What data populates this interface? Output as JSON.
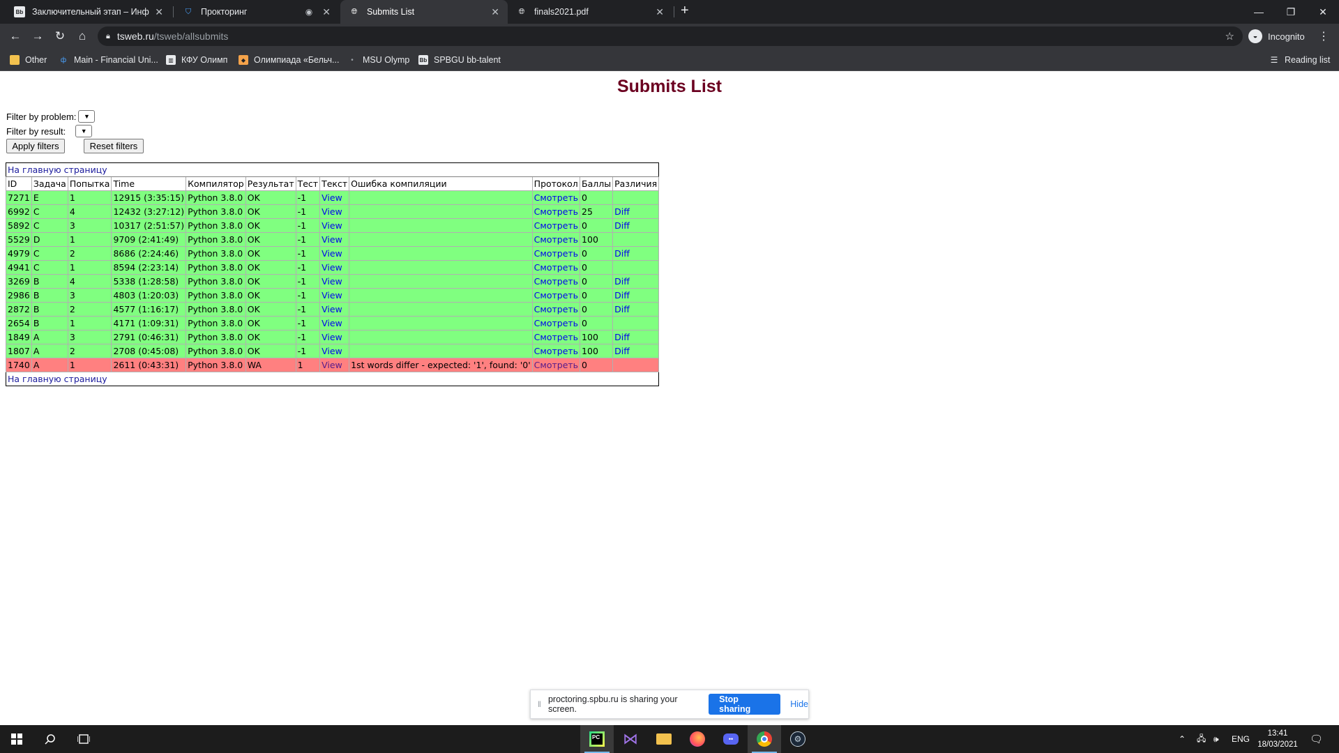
{
  "browser": {
    "tabs": [
      {
        "title": "Заключительный этап – Инфор",
        "icon": "bb-icon"
      },
      {
        "title": "Прокторинг",
        "icon": "shield-icon"
      },
      {
        "title": "Submits List",
        "icon": "globe-icon"
      },
      {
        "title": "finals2021.pdf",
        "icon": "globe-icon"
      }
    ],
    "address": {
      "host": "tsweb.ru",
      "path": "/tsweb/allsubmits"
    },
    "profile_label": "Incognito",
    "bookmarks": [
      "Other",
      "Main - Financial Uni...",
      "КФУ Олимп",
      "Олимпиада «Бельч...",
      "MSU Olymp",
      "SPBGU bb-talent"
    ],
    "reading_list": "Reading list"
  },
  "page": {
    "title": "Submits List",
    "filter_problem_label": "Filter by problem:",
    "filter_result_label": "Filter by result:",
    "apply_label": "Apply filters",
    "reset_label": "Reset filters",
    "home_link": "На главную страницу"
  },
  "table": {
    "headers": [
      "ID",
      "Задача",
      "Попытка",
      "Time",
      "Компилятор",
      "Результат",
      "Тест",
      "Текст",
      "Ошибка компиляции",
      "Протокол",
      "Баллы",
      "Различия"
    ],
    "rows": [
      {
        "id": "7271",
        "task": "E",
        "attempt": "1",
        "time": "12915 (3:35:15)",
        "compiler": "Python 3.8.0",
        "result": "OK",
        "test": "-1",
        "text": "View",
        "error": "",
        "protocol": "Смотреть",
        "score": "0",
        "diff": ""
      },
      {
        "id": "6992",
        "task": "C",
        "attempt": "4",
        "time": "12432 (3:27:12)",
        "compiler": "Python 3.8.0",
        "result": "OK",
        "test": "-1",
        "text": "View",
        "error": "",
        "protocol": "Смотреть",
        "score": "25",
        "diff": "Diff"
      },
      {
        "id": "5892",
        "task": "C",
        "attempt": "3",
        "time": "10317 (2:51:57)",
        "compiler": "Python 3.8.0",
        "result": "OK",
        "test": "-1",
        "text": "View",
        "error": "",
        "protocol": "Смотреть",
        "score": "0",
        "diff": "Diff"
      },
      {
        "id": "5529",
        "task": "D",
        "attempt": "1",
        "time": "9709 (2:41:49)",
        "compiler": "Python 3.8.0",
        "result": "OK",
        "test": "-1",
        "text": "View",
        "error": "",
        "protocol": "Смотреть",
        "score": "100",
        "diff": ""
      },
      {
        "id": "4979",
        "task": "C",
        "attempt": "2",
        "time": "8686 (2:24:46)",
        "compiler": "Python 3.8.0",
        "result": "OK",
        "test": "-1",
        "text": "View",
        "error": "",
        "protocol": "Смотреть",
        "score": "0",
        "diff": "Diff"
      },
      {
        "id": "4941",
        "task": "C",
        "attempt": "1",
        "time": "8594 (2:23:14)",
        "compiler": "Python 3.8.0",
        "result": "OK",
        "test": "-1",
        "text": "View",
        "error": "",
        "protocol": "Смотреть",
        "score": "0",
        "diff": ""
      },
      {
        "id": "3269",
        "task": "B",
        "attempt": "4",
        "time": "5338 (1:28:58)",
        "compiler": "Python 3.8.0",
        "result": "OK",
        "test": "-1",
        "text": "View",
        "error": "",
        "protocol": "Смотреть",
        "score": "0",
        "diff": "Diff"
      },
      {
        "id": "2986",
        "task": "B",
        "attempt": "3",
        "time": "4803 (1:20:03)",
        "compiler": "Python 3.8.0",
        "result": "OK",
        "test": "-1",
        "text": "View",
        "error": "",
        "protocol": "Смотреть",
        "score": "0",
        "diff": "Diff"
      },
      {
        "id": "2872",
        "task": "B",
        "attempt": "2",
        "time": "4577 (1:16:17)",
        "compiler": "Python 3.8.0",
        "result": "OK",
        "test": "-1",
        "text": "View",
        "error": "",
        "protocol": "Смотреть",
        "score": "0",
        "diff": "Diff"
      },
      {
        "id": "2654",
        "task": "B",
        "attempt": "1",
        "time": "4171 (1:09:31)",
        "compiler": "Python 3.8.0",
        "result": "OK",
        "test": "-1",
        "text": "View",
        "error": "",
        "protocol": "Смотреть",
        "score": "0",
        "diff": ""
      },
      {
        "id": "1849",
        "task": "A",
        "attempt": "3",
        "time": "2791 (0:46:31)",
        "compiler": "Python 3.8.0",
        "result": "OK",
        "test": "-1",
        "text": "View",
        "error": "",
        "protocol": "Смотреть",
        "score": "100",
        "diff": "Diff"
      },
      {
        "id": "1807",
        "task": "A",
        "attempt": "2",
        "time": "2708 (0:45:08)",
        "compiler": "Python 3.8.0",
        "result": "OK",
        "test": "-1",
        "text": "View",
        "error": "",
        "protocol": "Смотреть",
        "score": "100",
        "diff": "Diff"
      },
      {
        "id": "1740",
        "task": "A",
        "attempt": "1",
        "time": "2611 (0:43:31)",
        "compiler": "Python 3.8.0",
        "result": "WA",
        "test": "1",
        "text": "View",
        "error": "1st words differ - expected: '1', found: '0'",
        "protocol": "Смотреть",
        "score": "0",
        "diff": ""
      }
    ]
  },
  "sharing": {
    "message": "proctoring.spbu.ru is sharing your screen.",
    "stop_label": "Stop sharing",
    "hide_label": "Hide"
  },
  "taskbar": {
    "language": "ENG",
    "time": "13:41",
    "date": "18/03/2021"
  },
  "colors": {
    "ok_row": "#80ff80",
    "wa_row": "#ff8080",
    "title": "#6b0020",
    "accent": "#1a73e8"
  }
}
